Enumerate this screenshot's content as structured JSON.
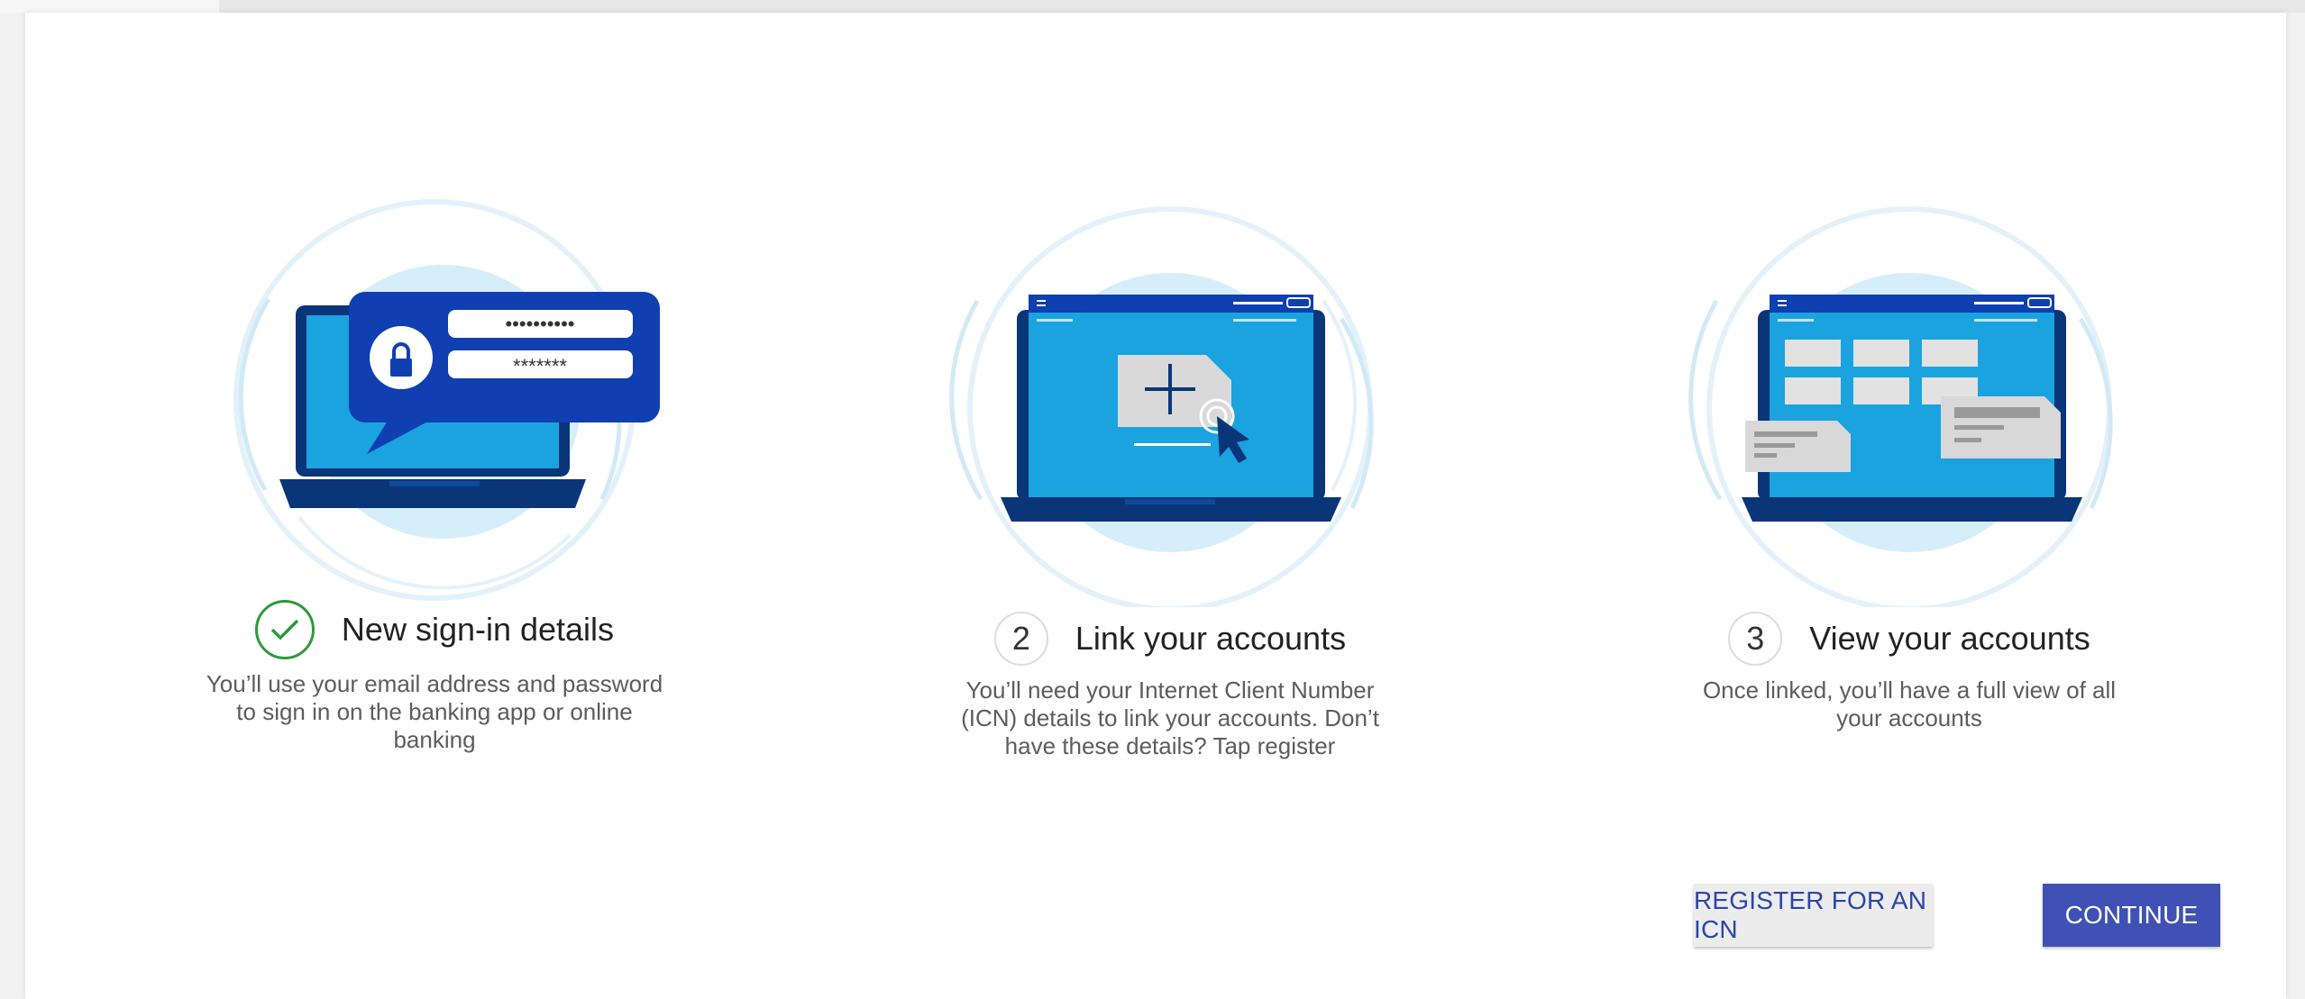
{
  "steps": [
    {
      "status": "complete",
      "status_icon": "check-icon",
      "title": "New sign-in details",
      "description": "You’ll use your email address and password to sign in on the banking app or online banking",
      "illustration": {
        "password_masks": [
          "••••••••••",
          "*******"
        ]
      }
    },
    {
      "number": "2",
      "title": "Link your accounts",
      "description": "You’ll need your Internet Client Number (ICN) details to link your accounts. Don’t have these details? Tap register"
    },
    {
      "number": "3",
      "title": "View your accounts",
      "description": "Once linked, you’ll have a full view of all your accounts"
    }
  ],
  "actions": {
    "register_label": "REGISTER FOR AN ICN",
    "continue_label": "CONTINUE"
  },
  "colors": {
    "brand_navy": "#0a3578",
    "brand_blue": "#0f3fb0",
    "screen_blue": "#1aa3de",
    "halo": "#d9eef8",
    "success_green": "#2e9a3a",
    "primary_button": "#3f51b5"
  }
}
